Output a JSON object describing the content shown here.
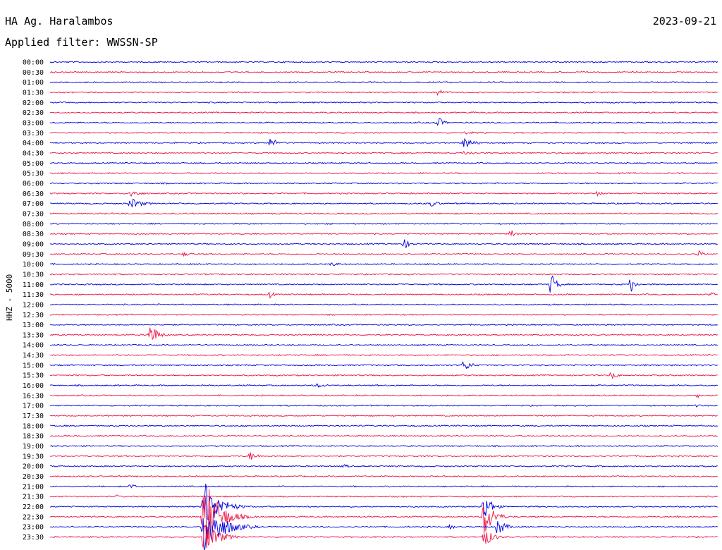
{
  "header": {
    "station": "HA Ag. Haralambos",
    "filter": "Applied filter: WWSSN-SP",
    "date": "2023-09-21"
  },
  "channel_label": "HHZ - 5000",
  "colors": {
    "blue": "#0000e0",
    "red": "#ee1144",
    "text": "#000000",
    "background": "#ffffff"
  },
  "chart_data": {
    "type": "line",
    "title": "",
    "series_color_pattern": [
      "blue",
      "red"
    ],
    "time_labels": [
      "00:00",
      "00:30",
      "01:00",
      "01:30",
      "02:00",
      "02:30",
      "03:00",
      "03:30",
      "04:00",
      "04:30",
      "05:00",
      "05:30",
      "06:00",
      "06:30",
      "07:00",
      "07:30",
      "08:00",
      "08:30",
      "09:00",
      "09:30",
      "10:00",
      "10:30",
      "11:00",
      "11:30",
      "12:00",
      "12:30",
      "13:00",
      "13:30",
      "14:00",
      "14:30",
      "15:00",
      "15:30",
      "16:00",
      "16:30",
      "17:00",
      "17:30",
      "18:00",
      "18:30",
      "19:00",
      "19:30",
      "20:00",
      "20:30",
      "21:00",
      "21:30",
      "22:00",
      "22:30",
      "23:00",
      "23:30"
    ],
    "events": [
      {
        "row": 3,
        "t": 0.58,
        "amp": 5,
        "dur": 0.05
      },
      {
        "row": 6,
        "t": 0.58,
        "amp": 10,
        "dur": 0.03
      },
      {
        "row": 7,
        "t": 0.62,
        "amp": 2,
        "dur": 0.18
      },
      {
        "row": 8,
        "t": 0.33,
        "amp": 7,
        "dur": 0.05
      },
      {
        "row": 8,
        "t": 0.62,
        "amp": 9,
        "dur": 0.05
      },
      {
        "row": 9,
        "t": 0.62,
        "amp": 3,
        "dur": 0.08
      },
      {
        "row": 13,
        "t": 0.12,
        "amp": 6,
        "dur": 0.06
      },
      {
        "row": 13,
        "t": 0.82,
        "amp": 4,
        "dur": 0.03
      },
      {
        "row": 14,
        "t": 0.12,
        "amp": 9,
        "dur": 0.06
      },
      {
        "row": 14,
        "t": 0.57,
        "amp": 5,
        "dur": 0.05
      },
      {
        "row": 17,
        "t": 0.69,
        "amp": 6,
        "dur": 0.04
      },
      {
        "row": 18,
        "t": 0.53,
        "amp": 7,
        "dur": 0.04
      },
      {
        "row": 19,
        "t": 0.2,
        "amp": 3,
        "dur": 0.06
      },
      {
        "row": 19,
        "t": 0.97,
        "amp": 6,
        "dur": 0.03
      },
      {
        "row": 20,
        "t": 0.42,
        "amp": 3,
        "dur": 0.07
      },
      {
        "row": 22,
        "t": 0.75,
        "amp": 18,
        "dur": 0.03
      },
      {
        "row": 22,
        "t": 0.87,
        "amp": 16,
        "dur": 0.02
      },
      {
        "row": 23,
        "t": 0.33,
        "amp": 6,
        "dur": 0.02
      },
      {
        "row": 23,
        "t": 0.99,
        "amp": 5,
        "dur": 0.02
      },
      {
        "row": 27,
        "t": 0.15,
        "amp": 18,
        "dur": 0.04
      },
      {
        "row": 30,
        "t": 0.62,
        "amp": 9,
        "dur": 0.04
      },
      {
        "row": 31,
        "t": 0.84,
        "amp": 7,
        "dur": 0.03
      },
      {
        "row": 32,
        "t": 0.4,
        "amp": 3,
        "dur": 0.08
      },
      {
        "row": 33,
        "t": 0.97,
        "amp": 4,
        "dur": 0.02
      },
      {
        "row": 34,
        "t": 0.97,
        "amp": 4,
        "dur": 0.02
      },
      {
        "row": 39,
        "t": 0.3,
        "amp": 7,
        "dur": 0.04
      },
      {
        "row": 40,
        "t": 0.44,
        "amp": 3,
        "dur": 0.04
      },
      {
        "row": 42,
        "t": 0.12,
        "amp": 5,
        "dur": 0.03
      },
      {
        "row": 43,
        "t": 0.1,
        "amp": 3,
        "dur": 0.02
      },
      {
        "row": 44,
        "t": 0.23,
        "amp": 40,
        "dur": 0.08
      },
      {
        "row": 44,
        "t": 0.65,
        "amp": 22,
        "dur": 0.04
      },
      {
        "row": 45,
        "t": 0.23,
        "amp": 60,
        "dur": 0.08
      },
      {
        "row": 45,
        "t": 0.65,
        "amp": 30,
        "dur": 0.05
      },
      {
        "row": 45,
        "t": 0.94,
        "amp": 3,
        "dur": 0.02
      },
      {
        "row": 46,
        "t": 0.23,
        "amp": 40,
        "dur": 0.1
      },
      {
        "row": 46,
        "t": 0.6,
        "amp": 5,
        "dur": 0.02
      },
      {
        "row": 46,
        "t": 0.67,
        "amp": 14,
        "dur": 0.04
      },
      {
        "row": 47,
        "t": 0.23,
        "amp": 22,
        "dur": 0.08
      },
      {
        "row": 47,
        "t": 0.65,
        "amp": 14,
        "dur": 0.05
      }
    ]
  }
}
